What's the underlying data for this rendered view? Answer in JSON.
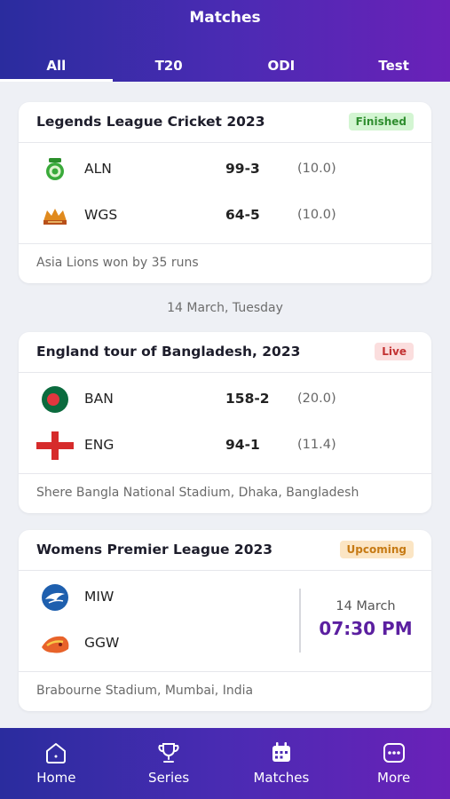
{
  "header": {
    "title": "Matches"
  },
  "tabs": [
    {
      "label": "All",
      "active": true
    },
    {
      "label": "T20",
      "active": false
    },
    {
      "label": "ODI",
      "active": false
    },
    {
      "label": "Test",
      "active": false
    }
  ],
  "matches": [
    {
      "series": "Legends League Cricket 2023",
      "status": "Finished",
      "teams": [
        {
          "code": "ALN",
          "score": "99-3",
          "overs": "(10.0)",
          "logo": "asia-lions-logo"
        },
        {
          "code": "WGS",
          "score": "64-5",
          "overs": "(10.0)",
          "logo": "world-giants-logo"
        }
      ],
      "footer": "Asia Lions won by 35 runs"
    },
    {
      "series": "England tour of Bangladesh, 2023",
      "status": "Live",
      "teams": [
        {
          "code": "BAN",
          "score": "158-2",
          "overs": "(20.0)",
          "logo": "bangladesh-flag"
        },
        {
          "code": "ENG",
          "score": "94-1",
          "overs": "(11.4)",
          "logo": "england-flag"
        }
      ],
      "footer": "Shere Bangla National Stadium, Dhaka, Bangladesh"
    },
    {
      "series": "Womens Premier League 2023",
      "status": "Upcoming",
      "teams": [
        {
          "code": "MIW",
          "logo": "mumbai-indians-logo"
        },
        {
          "code": "GGW",
          "logo": "gujarat-giants-logo"
        }
      ],
      "schedule": {
        "date": "14 March",
        "time": "07:30 PM"
      },
      "footer": "Brabourne Stadium, Mumbai, India"
    }
  ],
  "date_separator": "14 March, Tuesday",
  "bottom_nav": [
    {
      "label": "Home",
      "icon": "home-icon"
    },
    {
      "label": "Series",
      "icon": "trophy-icon"
    },
    {
      "label": "Matches",
      "icon": "calendar-icon",
      "active": true
    },
    {
      "label": "More",
      "icon": "more-icon"
    }
  ],
  "colors": {
    "gradient_start": "#2a2c9e",
    "gradient_end": "#6a21b8",
    "time_accent": "#5b1fa0",
    "finished": "#2f8e2f",
    "live": "#c33232",
    "upcoming": "#c67a14"
  }
}
